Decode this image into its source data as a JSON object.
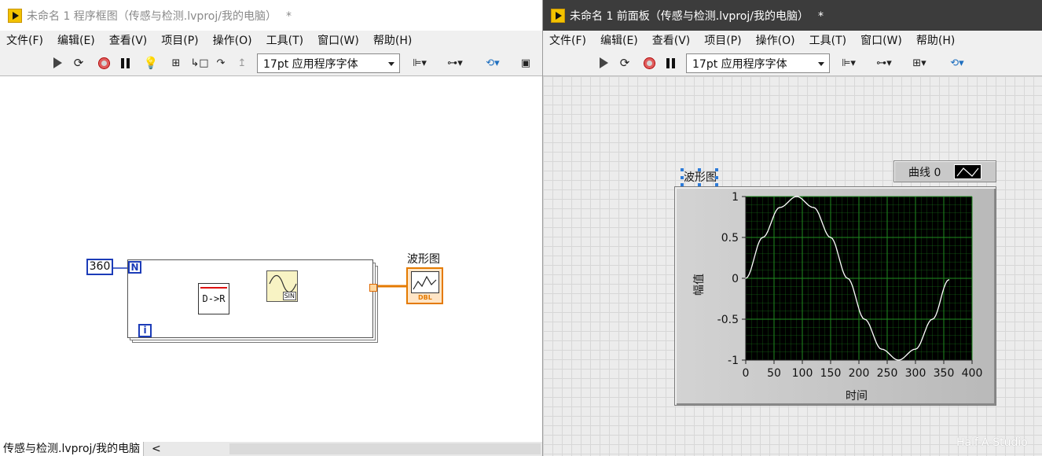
{
  "left_window": {
    "title": "未命名 1 程序框图（传感与检测.lvproj/我的电脑）",
    "modified_mark": "*",
    "menu": [
      "文件(F)",
      "编辑(E)",
      "查看(V)",
      "项目(P)",
      "操作(O)",
      "工具(T)",
      "窗口(W)",
      "帮助(H)"
    ],
    "font_select": "17pt 应用程序字体",
    "diagram": {
      "constant_value": "360",
      "count_terminal": "N",
      "iteration_terminal": "i",
      "convert_label": "D->R",
      "sine_label": "SIN",
      "graph_terminal_label": "波形图",
      "graph_terminal_badge": "DBL"
    },
    "status": {
      "project_path": "传感与检测.lvproj/我的电脑",
      "chevron": "<"
    }
  },
  "right_window": {
    "title": "未命名 1 前面板（传感与检测.lvproj/我的电脑）",
    "modified_mark": "*",
    "menu": [
      "文件(F)",
      "编辑(E)",
      "查看(V)",
      "项目(P)",
      "操作(O)",
      "工具(T)",
      "窗口(W)",
      "帮助(H)"
    ],
    "font_select": "17pt 应用程序字体",
    "graph_label": "波形图",
    "legend_label": "曲线 0",
    "watermark": "Half-A-Studio"
  },
  "colors": {
    "plot_bg": "#000000",
    "grid": "#1f8c1f",
    "trace": "#ffffff",
    "wire_numeric": "#1c3cb8",
    "wire_dbl": "#e47a00",
    "accent_logo": "#f2c200"
  },
  "chart_data": {
    "type": "line",
    "title": "波形图",
    "xlabel": "时间",
    "ylabel": "幅值",
    "xlim": [
      0,
      400
    ],
    "ylim": [
      -1,
      1
    ],
    "x_ticks": [
      0,
      50,
      100,
      150,
      200,
      250,
      300,
      350,
      400
    ],
    "y_ticks": [
      1,
      0.5,
      0,
      -0.5,
      -1
    ],
    "grid": true,
    "legend_position": "top-right",
    "series": [
      {
        "name": "曲线 0",
        "x": [
          0,
          30,
          60,
          90,
          120,
          150,
          180,
          210,
          240,
          270,
          300,
          330,
          359
        ],
        "y": [
          0,
          0.5,
          0.866,
          1,
          0.866,
          0.5,
          0,
          -0.5,
          -0.866,
          -1,
          -0.866,
          -0.5,
          -0.017
        ]
      }
    ]
  }
}
